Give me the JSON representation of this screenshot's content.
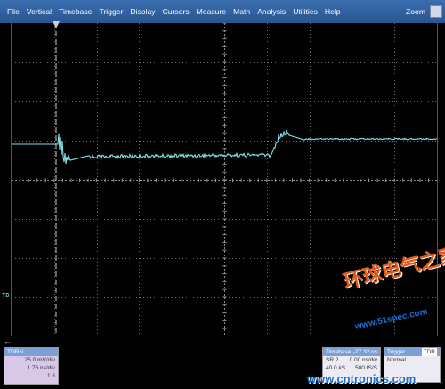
{
  "menu": {
    "items": [
      "File",
      "Vertical",
      "Timebase",
      "Trigger",
      "Display",
      "Cursors",
      "Measure",
      "Math",
      "Analysis",
      "Utilities",
      "Help"
    ],
    "zoom_label": "Zoom"
  },
  "screen": {
    "channel_marker": "TD",
    "trace_color": "#7fe3ea",
    "grid_color": "#6f6f6f"
  },
  "channel_box": {
    "title": "TDRN",
    "rows": [
      "25.0 mV/div",
      "1.76 ns/div",
      "1.6"
    ]
  },
  "timebase_box": {
    "title": "Timebase",
    "value": "-27.32 ns",
    "rows": [
      [
        "SR 2",
        "0.00 ns/div"
      ],
      [
        "40.0 kS",
        "500 fS/S"
      ]
    ]
  },
  "trigger_box": {
    "title": "Trigger",
    "tag": "TDR",
    "mode": "Normal"
  },
  "watermark": {
    "line1": "环球电气之家",
    "line2": "www.51spec.com",
    "line3": "www.cntronics.com"
  }
}
